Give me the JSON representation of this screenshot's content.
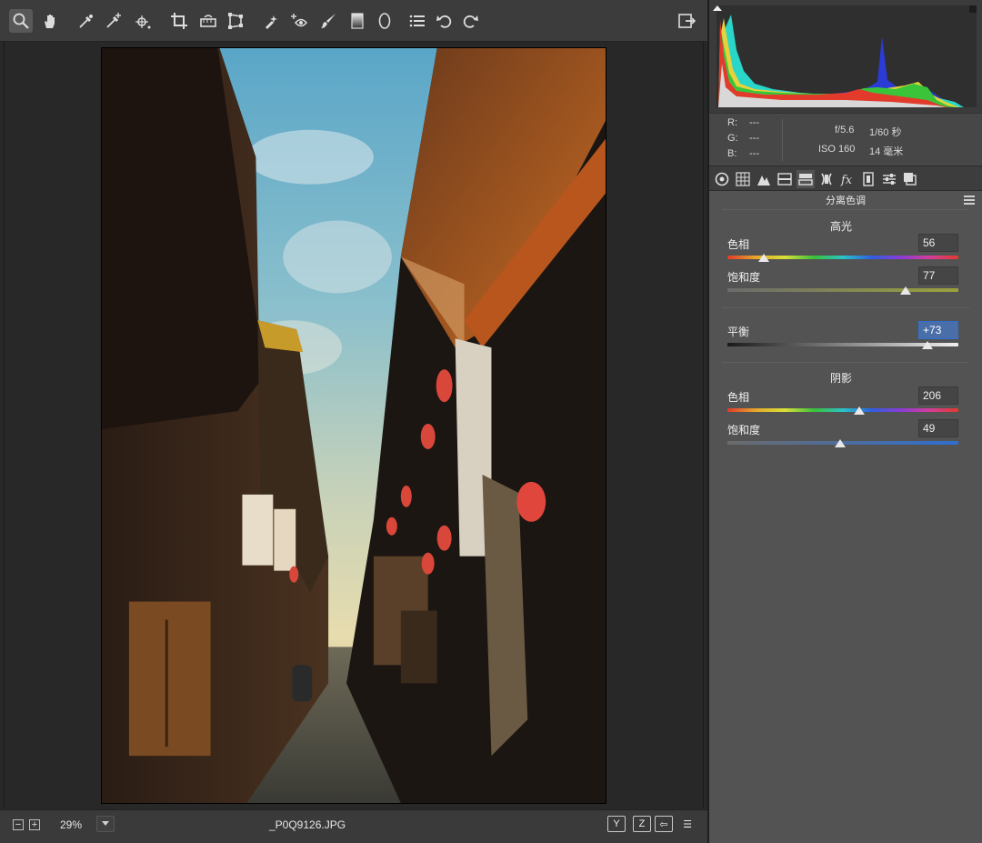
{
  "filename": "_P0Q9126.JPG",
  "zoom": {
    "value": "29%",
    "minus": "−",
    "plus": "+"
  },
  "info": {
    "r_label": "R:",
    "r_value": "---",
    "g_label": "G:",
    "g_value": "---",
    "b_label": "B:",
    "b_value": "---",
    "aperture": "f/5.6",
    "shutter": "1/60 秒",
    "iso": "ISO 160",
    "focal": "14 毫米"
  },
  "panel": {
    "title": "分离色调",
    "highlights": {
      "title": "高光",
      "hue_label": "色相",
      "hue_value": "56",
      "hue_level": 0.156,
      "sat_label": "饱和度",
      "sat_value": "77",
      "sat_level": 0.77
    },
    "balance": {
      "label": "平衡",
      "value": "+73",
      "level": 0.865
    },
    "shadows": {
      "title": "阴影",
      "hue_label": "色相",
      "hue_value": "206",
      "hue_level": 0.572,
      "sat_label": "饱和度",
      "sat_value": "49",
      "sat_level": 0.49
    }
  },
  "statusbar_buttons": [
    "Y",
    "Z",
    "⇦",
    "☰"
  ],
  "icons": {
    "toolbar": [
      "zoom-icon",
      "hand-icon",
      "white-balance-icon",
      "color-sampler-icon",
      "target-adjust-icon",
      "crop-icon",
      "straighten-icon",
      "transform-icon",
      "spot-removal-icon",
      "red-eye-icon",
      "adjustment-brush-icon",
      "graduated-filter-icon",
      "radial-filter-icon",
      "preferences-icon",
      "rotate-left-icon",
      "rotate-right-icon",
      "open-image-icon"
    ]
  }
}
